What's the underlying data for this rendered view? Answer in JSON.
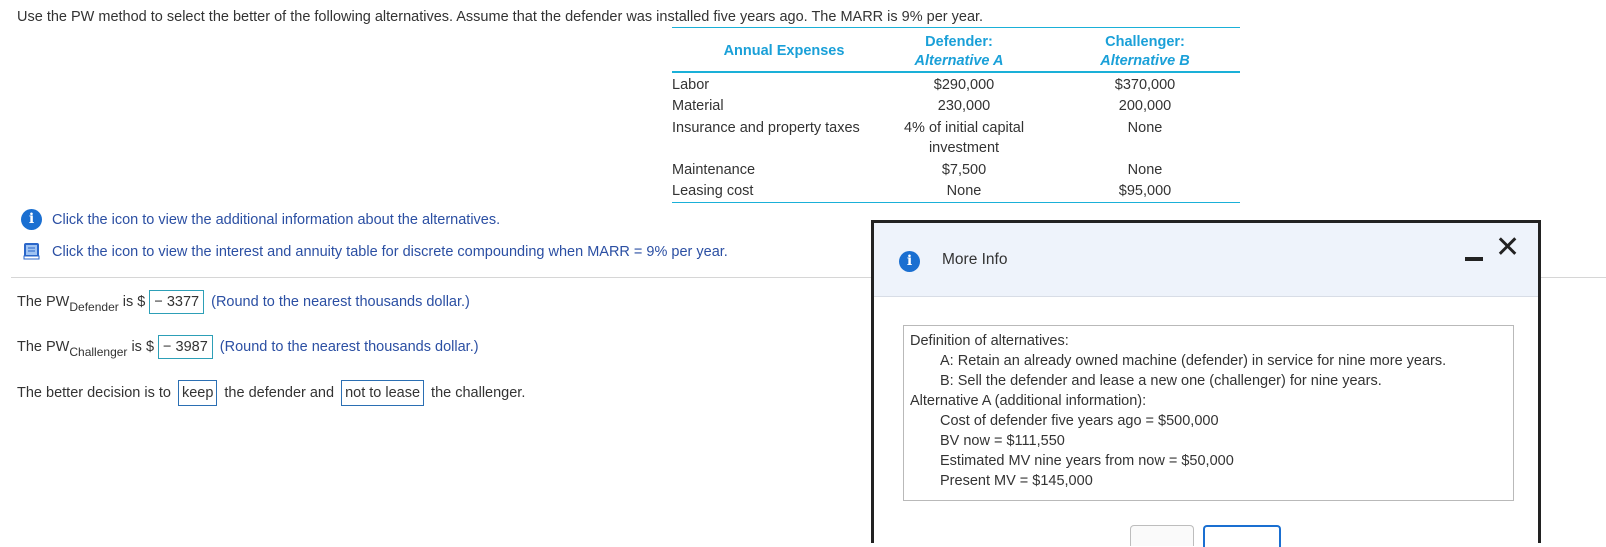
{
  "question": "Use the PW method to select the better of the following alternatives. Assume that the defender was installed five years ago. The MARR is 9% per year.",
  "table": {
    "col_annual": "Annual Expenses",
    "col_def_1": "Defender:",
    "col_def_2": "Alternative A",
    "col_chal_1": "Challenger:",
    "col_chal_2": "Alternative B",
    "rows": [
      {
        "label": "Labor",
        "def": "$290,000",
        "chal": "$370,000"
      },
      {
        "label": "Material",
        "def": "230,000",
        "chal": "200,000"
      },
      {
        "label": "Insurance and property taxes",
        "def": "4% of initial capital investment",
        "chal": "None"
      },
      {
        "label": "Maintenance",
        "def": "$7,500",
        "chal": "None"
      },
      {
        "label": "Leasing cost",
        "def": "None",
        "chal": "$95,000"
      }
    ]
  },
  "links": {
    "info": "Click the icon to view the additional information about the alternatives.",
    "table": "Click the icon to view the interest and annuity table for discrete compounding when MARR = 9% per year."
  },
  "answers": {
    "pw_prefix": "The PW",
    "pw_def_sub": "Defender",
    "pw_chal_sub": "Challenger",
    "is_dollar": "is $",
    "pw_def_value": "− 3377",
    "pw_chal_value": "− 3987",
    "round_hint": "(Round to the nearest thousands dollar.)",
    "decision_1": "The better decision is to",
    "decision_word_1": "keep",
    "decision_2": "the defender and",
    "decision_word_2": "not to lease",
    "decision_3": "the challenger."
  },
  "dialog": {
    "title": "More Info",
    "lines": [
      "Definition of alternatives:",
      "A: Retain an already owned machine (defender) in service for nine more years.",
      "B: Sell the defender and lease a new one (challenger) for nine years.",
      "Alternative A (additional information):",
      "Cost of defender five years ago = $500,000",
      "BV now = $111,550",
      "Estimated MV nine years from now = $50,000",
      "Present MV = $145,000"
    ]
  },
  "icons": {
    "info": "info-icon",
    "table": "book-icon",
    "minimize": "minimize-icon",
    "close": "close-icon"
  },
  "colors": {
    "table_accent": "#1ab0d8",
    "link": "#2b4fa3",
    "info_icon": "#1a6fd1"
  }
}
